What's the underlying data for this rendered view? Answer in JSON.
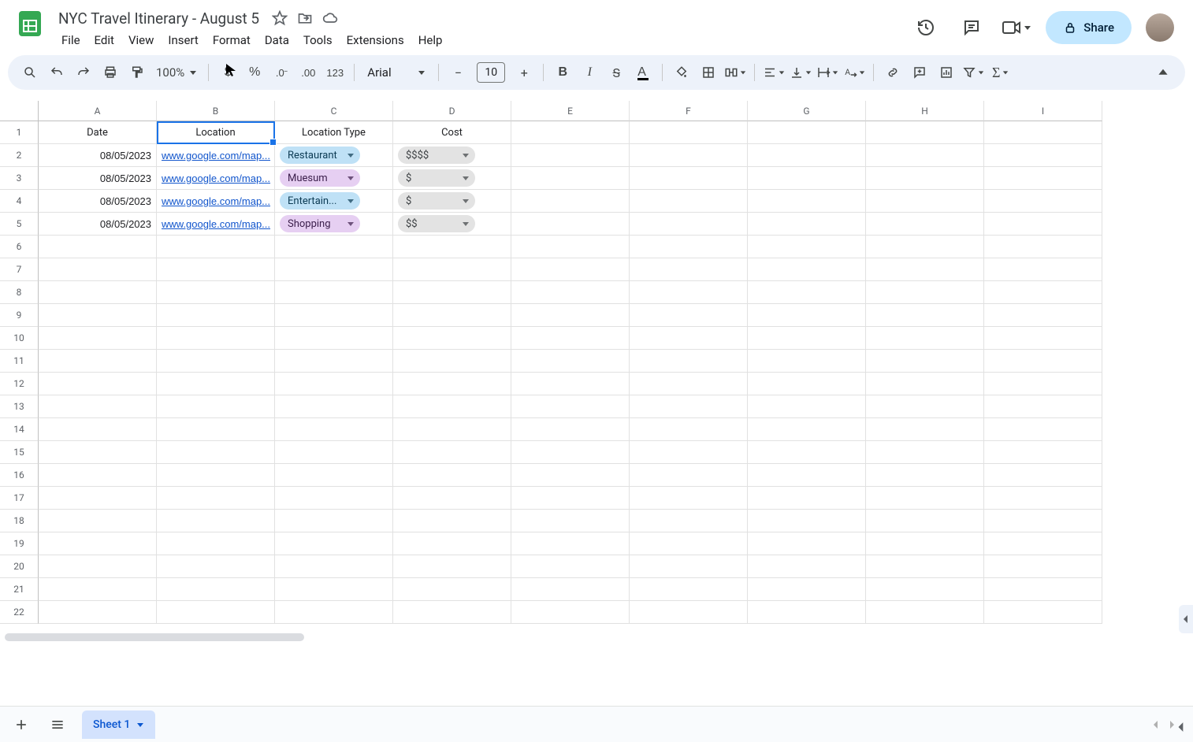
{
  "doc": {
    "title": "NYC Travel Itinerary - August 5"
  },
  "menubar": {
    "items": [
      "File",
      "Edit",
      "View",
      "Insert",
      "Format",
      "Data",
      "Tools",
      "Extensions",
      "Help"
    ]
  },
  "topright": {
    "share": "Share"
  },
  "toolbar": {
    "zoom": "100%",
    "font": "Arial",
    "fontsize": "10"
  },
  "columns": [
    "A",
    "B",
    "C",
    "D",
    "E",
    "F",
    "G",
    "H",
    "I"
  ],
  "rowcount": 22,
  "headers": {
    "A": "Date",
    "B": "Location",
    "C": "Location Type",
    "D": "Cost"
  },
  "rows": [
    {
      "date": "08/05/2023",
      "loc": "www.google.com/map...",
      "type": "Restaurant",
      "type_color": "blue",
      "cost": "$$$$"
    },
    {
      "date": "08/05/2023",
      "loc": "www.google.com/map...",
      "type": "Muesum",
      "type_color": "purple",
      "cost": "$"
    },
    {
      "date": "08/05/2023",
      "loc": "www.google.com/map...",
      "type": "Entertain...",
      "type_color": "blue",
      "cost": "$"
    },
    {
      "date": "08/05/2023",
      "loc": "www.google.com/map...",
      "type": "Shopping",
      "type_color": "purple",
      "cost": "$$"
    }
  ],
  "sheet": {
    "name": "Sheet 1"
  }
}
